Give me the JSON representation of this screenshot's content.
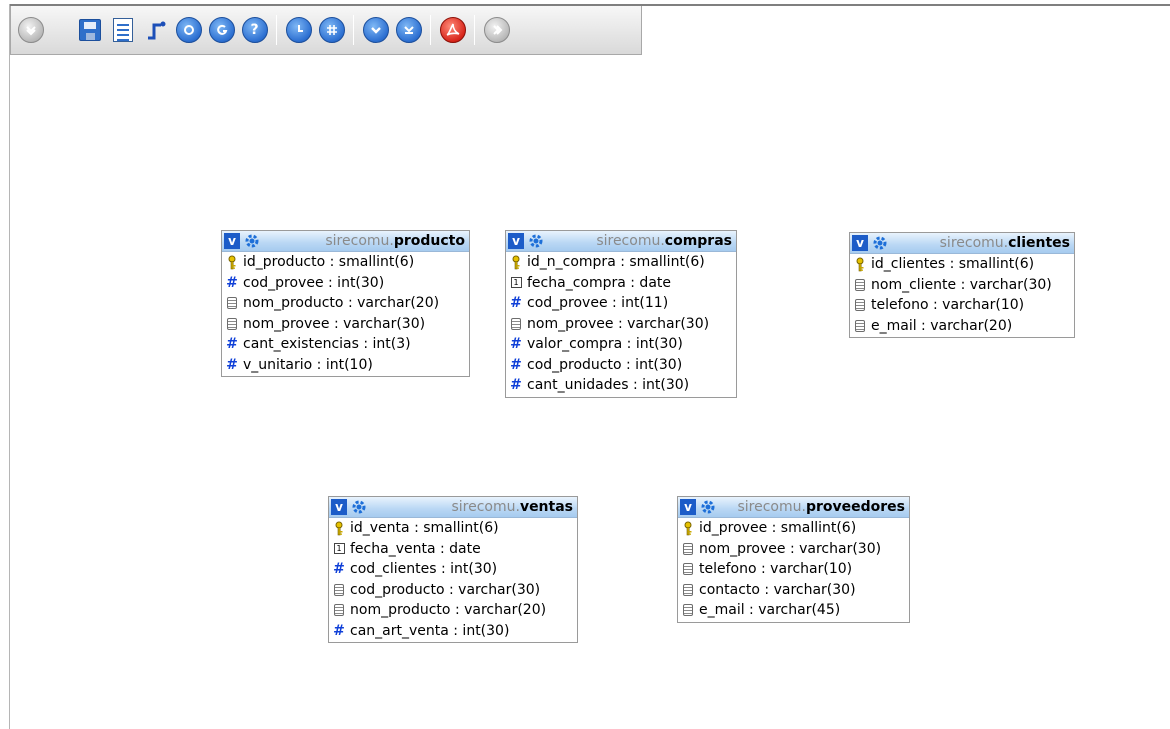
{
  "toolbar": {
    "buttons": [
      {
        "name": "toggle-menu-button",
        "icon": "chevron-down-icon"
      },
      {
        "name": "save-position-button",
        "icon": "save-icon"
      },
      {
        "name": "export-page-button",
        "icon": "document-icon"
      },
      {
        "name": "relation-button",
        "icon": "relation-icon"
      },
      {
        "name": "reload-button",
        "icon": "reload-icon"
      },
      {
        "name": "angular-links-button",
        "icon": "angular-icon"
      },
      {
        "name": "help-button",
        "icon": "help-icon"
      },
      {
        "name": "toggle-small-big-button",
        "icon": "toggle-icon"
      },
      {
        "name": "snap-to-grid-button",
        "icon": "grid-icon"
      },
      {
        "name": "show-all-button",
        "icon": "show-all-icon"
      },
      {
        "name": "hide-all-button",
        "icon": "hide-all-icon"
      },
      {
        "name": "export-pdf-button",
        "icon": "pdf-icon"
      },
      {
        "name": "collapse-button",
        "icon": "chevron-right-icon"
      }
    ],
    "accent": "#2c6fd1"
  },
  "tables": [
    {
      "id": "producto",
      "schema": "sirecomu.",
      "name": "producto",
      "columns": [
        {
          "icon": "key-icon",
          "text": "id_producto : smallint(6)"
        },
        {
          "icon": "hash-icon",
          "text": "cod_provee : int(30)"
        },
        {
          "icon": "text-icon",
          "text": "nom_producto : varchar(20)"
        },
        {
          "icon": "text-icon",
          "text": "nom_provee : varchar(30)"
        },
        {
          "icon": "hash-icon",
          "text": "cant_existencias : int(3)"
        },
        {
          "icon": "hash-icon",
          "text": "v_unitario : int(10)"
        }
      ]
    },
    {
      "id": "compras",
      "schema": "sirecomu.",
      "name": "compras",
      "columns": [
        {
          "icon": "key-icon",
          "text": "id_n_compra : smallint(6)"
        },
        {
          "icon": "date-icon",
          "text": "fecha_compra : date"
        },
        {
          "icon": "hash-icon",
          "text": "cod_provee : int(11)"
        },
        {
          "icon": "text-icon",
          "text": "nom_provee : varchar(30)"
        },
        {
          "icon": "hash-icon",
          "text": "valor_compra : int(30)"
        },
        {
          "icon": "hash-icon",
          "text": "cod_producto : int(30)"
        },
        {
          "icon": "hash-icon",
          "text": "cant_unidades : int(30)"
        }
      ]
    },
    {
      "id": "clientes",
      "schema": "sirecomu.",
      "name": "clientes",
      "columns": [
        {
          "icon": "key-icon",
          "text": "id_clientes : smallint(6)"
        },
        {
          "icon": "text-icon",
          "text": "nom_cliente : varchar(30)"
        },
        {
          "icon": "text-icon",
          "text": "telefono : varchar(10)"
        },
        {
          "icon": "text-icon",
          "text": "e_mail : varchar(20)"
        }
      ]
    },
    {
      "id": "ventas",
      "schema": "sirecomu.",
      "name": "ventas",
      "columns": [
        {
          "icon": "key-icon",
          "text": "id_venta : smallint(6)"
        },
        {
          "icon": "date-icon",
          "text": "fecha_venta : date"
        },
        {
          "icon": "hash-icon",
          "text": "cod_clientes : int(30)"
        },
        {
          "icon": "text-icon",
          "text": "cod_producto : varchar(30)"
        },
        {
          "icon": "text-icon",
          "text": "nom_producto : varchar(20)"
        },
        {
          "icon": "hash-icon",
          "text": "can_art_venta : int(30)"
        }
      ]
    },
    {
      "id": "proveedores",
      "schema": "sirecomu.",
      "name": "proveedores",
      "columns": [
        {
          "icon": "key-icon",
          "text": "id_provee : smallint(6)"
        },
        {
          "icon": "text-icon",
          "text": "nom_provee : varchar(30)"
        },
        {
          "icon": "text-icon",
          "text": "telefono : varchar(10)"
        },
        {
          "icon": "text-icon",
          "text": "contacto : varchar(30)"
        },
        {
          "icon": "text-icon",
          "text": "e_mail : varchar(45)"
        }
      ]
    }
  ]
}
